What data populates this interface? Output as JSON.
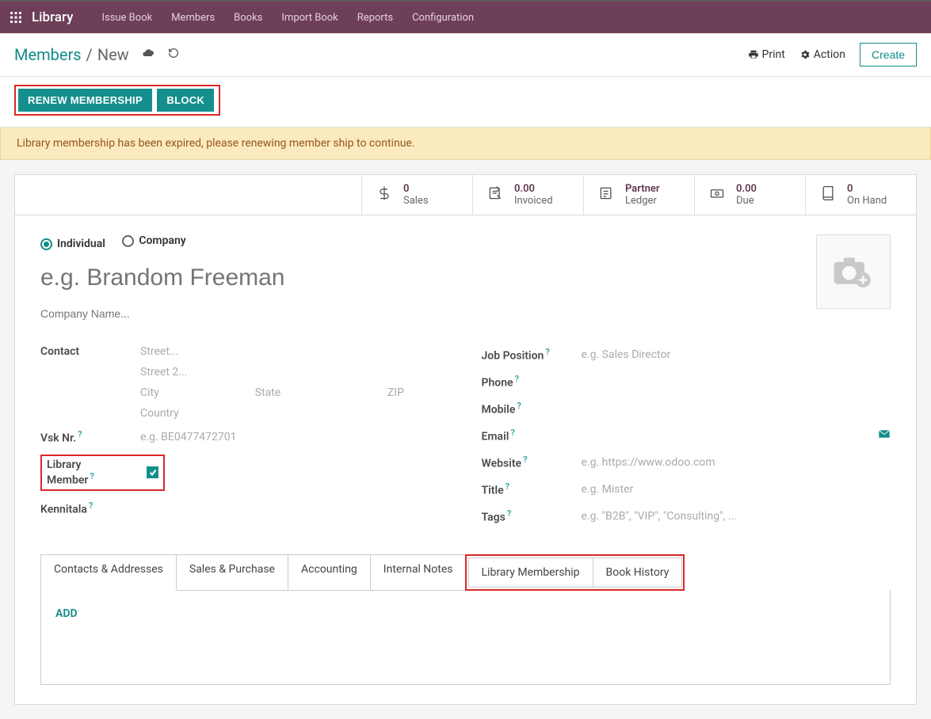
{
  "nav": {
    "brand": "Library",
    "items": [
      "Issue Book",
      "Members",
      "Books",
      "Import Book",
      "Reports",
      "Configuration"
    ]
  },
  "breadcrumb": {
    "parent": "Members",
    "current": "New",
    "print": "Print",
    "action": "Action",
    "create": "Create"
  },
  "top_buttons": {
    "renew": "RENEW MEMBERSHIP",
    "block": "BLOCK"
  },
  "alert": "Library membership has been expired, please renewing member ship to continue.",
  "stats": {
    "sales_v": "0",
    "sales_l": "Sales",
    "invoiced_v": "0.00",
    "invoiced_l": "Invoiced",
    "ledger_v": "Partner",
    "ledger_l": "Ledger",
    "due_v": "0.00",
    "due_l": "Due",
    "onhand_v": "0",
    "onhand_l": "On Hand"
  },
  "type": {
    "individual": "Individual",
    "company": "Company"
  },
  "name_ph": "e.g. Brandom Freeman",
  "company_ph": "Company Name...",
  "left": {
    "contact": "Contact",
    "street": "Street...",
    "street2": "Street 2...",
    "city": "City",
    "state": "State",
    "zip": "ZIP",
    "country": "Country",
    "vsk": "Vsk Nr.",
    "vsk_ph": "e.g. BE0477472701",
    "libmem": "Library Member",
    "kennitala": "Kennitala"
  },
  "right": {
    "job": "Job Position",
    "job_ph": "e.g. Sales Director",
    "phone": "Phone",
    "mobile": "Mobile",
    "email": "Email",
    "website": "Website",
    "website_ph": "e.g. https://www.odoo.com",
    "title": "Title",
    "title_ph": "e.g. Mister",
    "tags": "Tags",
    "tags_ph": "e.g. \"B2B\", \"VIP\", \"Consulting\", ..."
  },
  "tabs": {
    "contacts": "Contacts & Addresses",
    "sales": "Sales & Purchase",
    "accounting": "Accounting",
    "notes": "Internal Notes",
    "libmem": "Library Membership",
    "bookhist": "Book History",
    "add": "ADD"
  }
}
